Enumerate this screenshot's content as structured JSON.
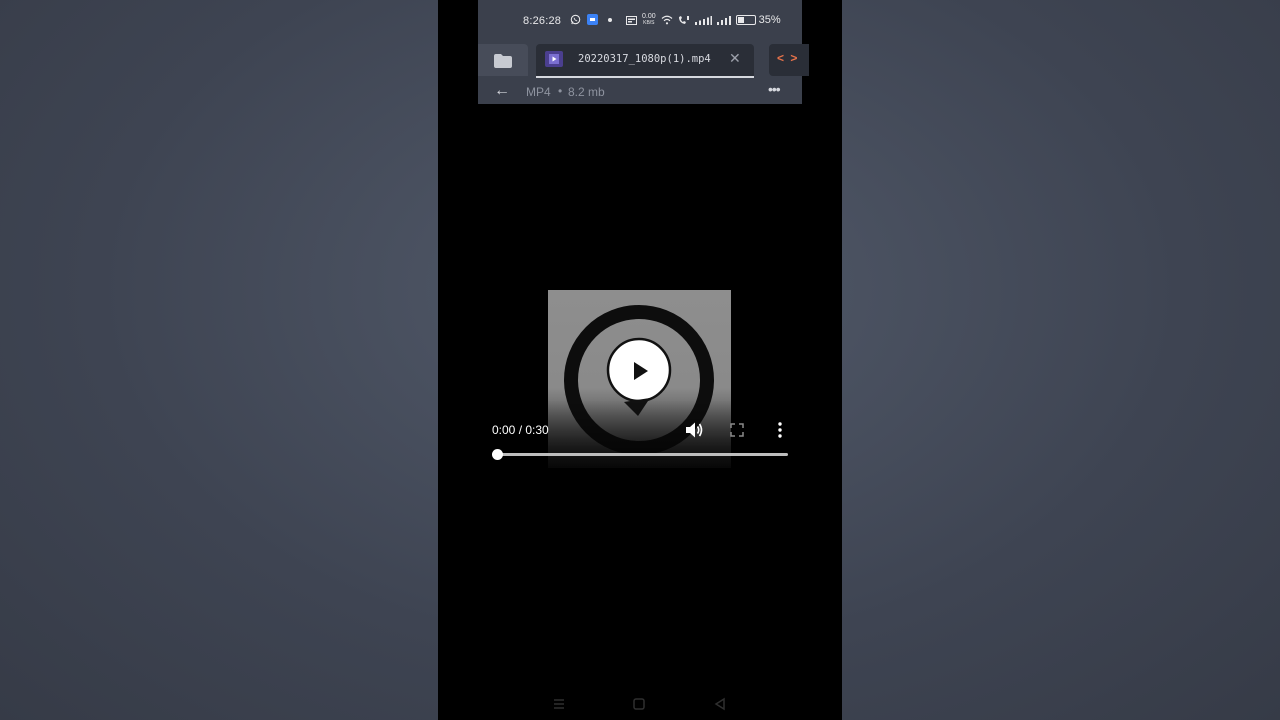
{
  "status_bar": {
    "time": "8:26:28",
    "net_speed_value": "0.00",
    "net_speed_unit": "KB/S",
    "battery": "35%"
  },
  "tabs": {
    "active_title": "20220317_1080p(1).mp4",
    "close_glyph": "✕"
  },
  "file_info": {
    "format": "MP4",
    "separator": "•",
    "size": "8.2 mb",
    "more_glyph": "•••",
    "back_glyph": "←"
  },
  "player": {
    "time_display": "0:00 / 0:30",
    "progress": 0.0,
    "icons": {
      "volume": "volume-icon",
      "fullscreen": "fullscreen-icon",
      "overflow": "overflow-menu-icon",
      "play": "play-icon"
    }
  },
  "code_tab": {
    "left": "<",
    "right": ">"
  },
  "colors": {
    "header_bg": "#3b404c",
    "tab_bg": "#2a2e37",
    "code_tab_accent": "#e8734a",
    "tab_icon": "#4b3f8f",
    "status_app_icon": "#3b82f6"
  }
}
